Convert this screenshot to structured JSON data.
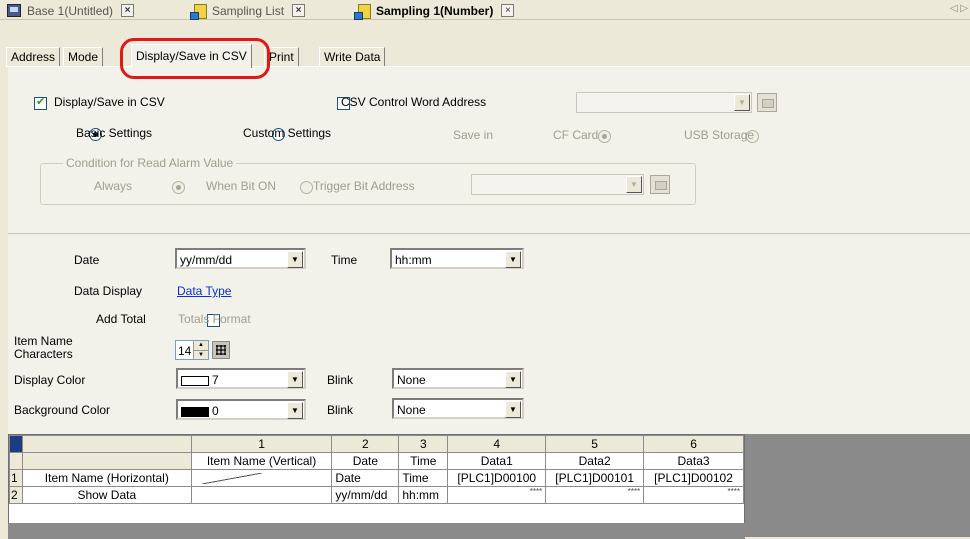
{
  "doc_tabs": [
    {
      "label": "Base 1(Untitled)",
      "icon": "screen-icon",
      "active": false
    },
    {
      "label": "Sampling List",
      "icon": "sampling-icon",
      "active": false
    },
    {
      "label": "Sampling 1(Number)",
      "icon": "sampling-icon",
      "active": true
    }
  ],
  "sub_tabs": [
    "Address",
    "Mode",
    "Display/Save in CSV",
    "Print",
    "Write Data"
  ],
  "active_sub_tab": "Display/Save in CSV",
  "highlight_color": "#e01818",
  "csv": {
    "display_save_label": "Display/Save in CSV",
    "display_save_checked": true,
    "csv_control_label": "CSV Control Word Address",
    "csv_control_checked": false,
    "basic_settings": "Basic Settings",
    "custom_settings": "Custom Settings",
    "settings_selected": "Basic Settings",
    "save_in_label": "Save in",
    "cf_card": "CF Card",
    "usb_storage": "USB Storage",
    "save_in_selected": "CF Card"
  },
  "alarm_group": {
    "title": "Condition for Read Alarm Value",
    "always": "Always",
    "when_bit_on": "When Bit ON",
    "trigger_label": "Trigger Bit Address",
    "selected": "Always"
  },
  "format": {
    "date_label": "Date",
    "date_value": "yy/mm/dd",
    "time_label": "Time",
    "time_value": "hh:mm",
    "data_display_label": "Data Display",
    "data_type_link": "Data Type",
    "add_total_label": "Add Total",
    "add_total_checked": false,
    "totals_format_label": "Totals Format",
    "item_name_label_1": "Item Name",
    "item_name_label_2": "Characters",
    "item_name_chars": "14",
    "display_color_label": "Display Color",
    "display_color_value": "7",
    "display_color_swatch": "#ffffff",
    "display_blink_label": "Blink",
    "display_blink_value": "None",
    "bg_color_label": "Background Color",
    "bg_color_value": "0",
    "bg_color_swatch": "#000000",
    "bg_blink_label": "Blink",
    "bg_blink_value": "None"
  },
  "grid": {
    "col_numbers": [
      "1",
      "2",
      "3",
      "4",
      "5",
      "6"
    ],
    "col_titles": [
      "Item Name (Vertical)",
      "Date",
      "Time",
      "Data1",
      "Data2",
      "Data3"
    ],
    "rows": [
      {
        "num": "1",
        "label": "Item Name (Horizontal)",
        "cells": [
          "",
          "Date",
          "Time",
          "[PLC1]D00100",
          "[PLC1]D00101",
          "[PLC1]D00102"
        ]
      },
      {
        "num": "2",
        "label": "Show Data",
        "cells": [
          "",
          "yy/mm/dd",
          "hh:mm",
          "****",
          "****",
          "****"
        ]
      }
    ]
  }
}
